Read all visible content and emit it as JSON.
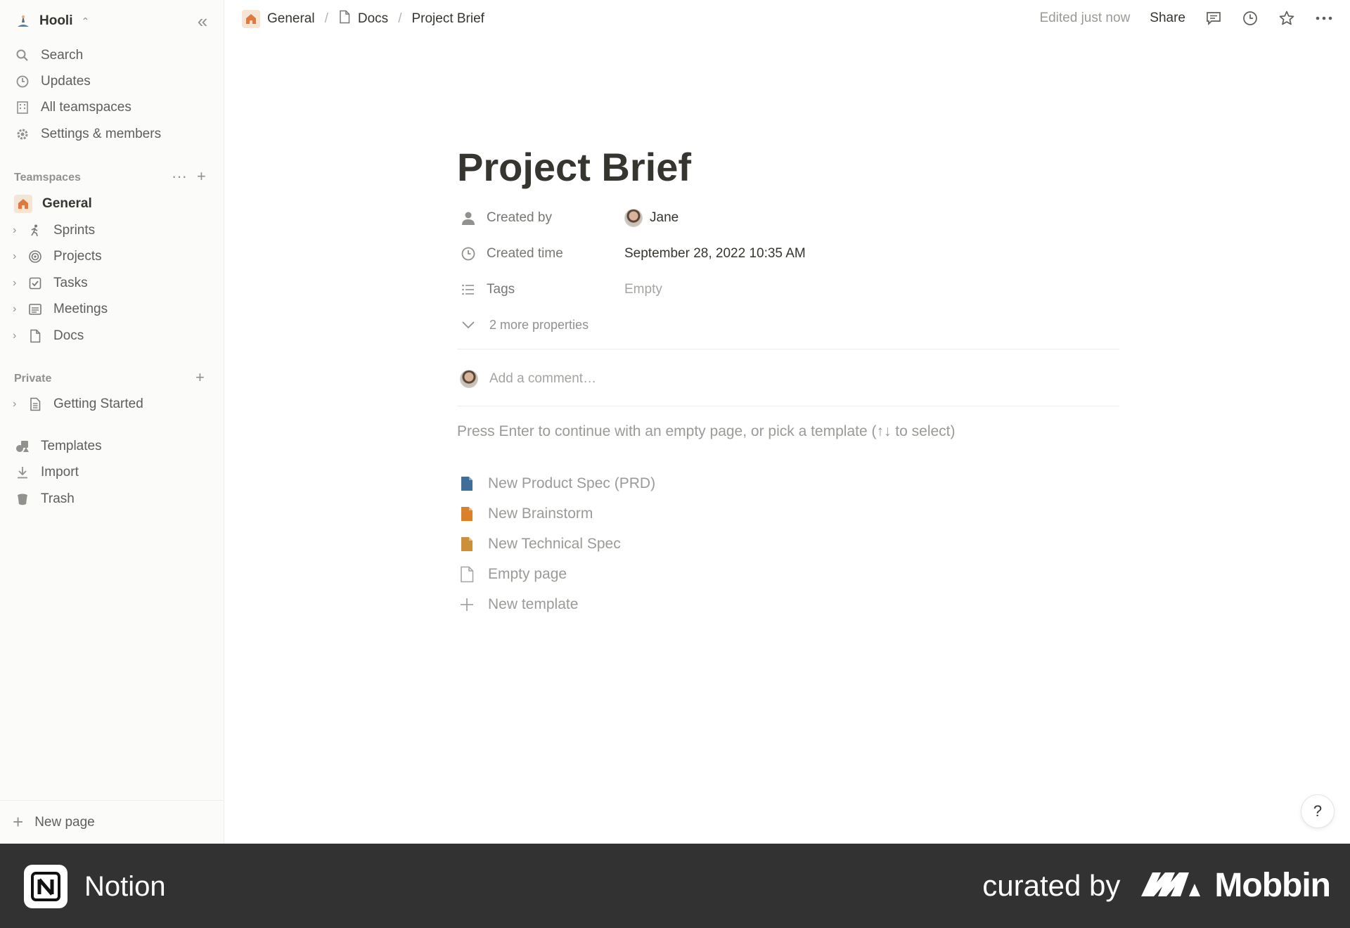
{
  "workspace": {
    "name": "Hooli"
  },
  "sidebar": {
    "nav": [
      {
        "label": "Search",
        "icon": "search-icon"
      },
      {
        "label": "Updates",
        "icon": "clock-icon"
      },
      {
        "label": "All teamspaces",
        "icon": "building-icon"
      },
      {
        "label": "Settings & members",
        "icon": "gear-icon"
      }
    ],
    "teamspaces_label": "Teamspaces",
    "teamspace_items": [
      {
        "label": "General",
        "icon": "home-icon"
      },
      {
        "label": "Sprints",
        "icon": "runner-icon"
      },
      {
        "label": "Projects",
        "icon": "target-icon"
      },
      {
        "label": "Tasks",
        "icon": "checkbox-icon"
      },
      {
        "label": "Meetings",
        "icon": "notes-icon"
      },
      {
        "label": "Docs",
        "icon": "page-icon"
      }
    ],
    "private_label": "Private",
    "private_items": [
      {
        "label": "Getting Started",
        "icon": "document-icon"
      }
    ],
    "tools": [
      {
        "label": "Templates",
        "icon": "shapes-icon"
      },
      {
        "label": "Import",
        "icon": "download-icon"
      },
      {
        "label": "Trash",
        "icon": "trash-icon"
      }
    ],
    "new_page_label": "New page"
  },
  "topbar": {
    "breadcrumbs": [
      "General",
      "Docs",
      "Project Brief"
    ],
    "edited": "Edited just now",
    "share": "Share"
  },
  "page": {
    "title": "Project Brief",
    "properties": [
      {
        "label": "Created by",
        "value": "Jane",
        "icon": "person-icon"
      },
      {
        "label": "Created time",
        "value": "September 28, 2022 10:35 AM",
        "icon": "clock-icon"
      },
      {
        "label": "Tags",
        "value": "Empty",
        "icon": "list-icon"
      }
    ],
    "more_properties": "2 more properties",
    "comment_placeholder": "Add a comment…",
    "hint": "Press Enter to continue with an empty page, or pick a template (↑↓ to select)",
    "templates": [
      {
        "label": "New Product Spec (PRD)",
        "icon": "doc-blue-icon",
        "color": "#3f6f96"
      },
      {
        "label": "New Brainstorm",
        "icon": "doc-orange-icon",
        "color": "#d9822b"
      },
      {
        "label": "New Technical Spec",
        "icon": "doc-gold-icon",
        "color": "#cc8f3a"
      },
      {
        "label": "Empty page",
        "icon": "page-icon",
        "color": "#a5a4a1"
      },
      {
        "label": "New template",
        "icon": "plus-icon",
        "color": "#a5a4a1"
      }
    ]
  },
  "help": "?",
  "footer": {
    "app_name": "Notion",
    "curated_by": "curated by",
    "curator": "Mobbin"
  }
}
